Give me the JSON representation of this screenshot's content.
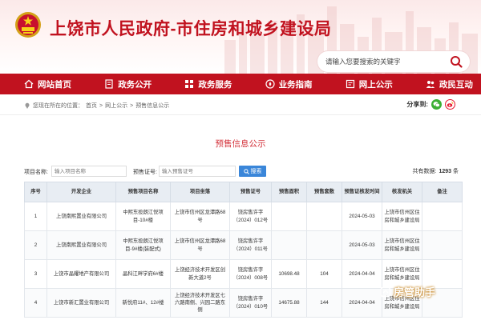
{
  "header": {
    "title": "上饶市人民政府-市住房和城乡建设局",
    "search_placeholder": "请输入您要搜索的关键字"
  },
  "nav": {
    "items": [
      {
        "label": "网站首页",
        "icon": "home-icon"
      },
      {
        "label": "政务公开",
        "icon": "document-icon"
      },
      {
        "label": "政务服务",
        "icon": "grid-icon"
      },
      {
        "label": "业务指南",
        "icon": "guide-icon"
      },
      {
        "label": "网上公示",
        "icon": "notice-icon"
      },
      {
        "label": "政民互动",
        "icon": "people-icon"
      }
    ]
  },
  "breadcrumb": {
    "prefix": "您现在所在的位置：",
    "home": "首页",
    "sep": ">",
    "section": "网上公示",
    "current": "预售信息公示"
  },
  "share": {
    "label": "分享到:"
  },
  "page_title": "预售信息公示",
  "filter": {
    "project_label": "项目名称:",
    "project_placeholder": "输入项目名称",
    "cert_label": "预售证号:",
    "cert_placeholder": "输入预售证号",
    "search_button": "搜索",
    "total_label": "共有数据:",
    "total_count": "1293",
    "total_unit": "条"
  },
  "table": {
    "headers": [
      "序号",
      "开发企业",
      "预售项目名称",
      "项目坐落",
      "预售证号",
      "预售面积",
      "预售套数",
      "预售证核发时间",
      "核发机关",
      "备注"
    ],
    "rows": [
      {
        "no": "1",
        "company": "上饶南熙置业有限公司",
        "project": "中熙东投朗江悦项目-10#楼",
        "location": "上饶市信州区龙潭路68号",
        "cert": "饶房售许字（2024）012号",
        "area": "",
        "units": "",
        "date": "2024-05-03",
        "authority": "上饶市信州区住房和城乡建设局",
        "remark": ""
      },
      {
        "no": "2",
        "company": "上饶南熙置业有限公司",
        "project": "中熙东投朗江悦项目-9#楼(装配式)",
        "location": "上饶市信州区龙潭路68号",
        "cert": "饶房售许字（2024）011号",
        "area": "",
        "units": "",
        "date": "2024-05-03",
        "authority": "上饶市信州区住房和城乡建设局",
        "remark": ""
      },
      {
        "no": "3",
        "company": "上饶市晶耀地产有限公司",
        "project": "晶科江畔学府6#楼",
        "location": "上饶经济技术开发区创新大道2号",
        "cert": "饶房售许字（2024）008号",
        "area": "10698.48",
        "units": "104",
        "date": "2024-04-04",
        "authority": "上饶市信州区住房和城乡建设局",
        "remark": ""
      },
      {
        "no": "4",
        "company": "上饶市新汇置业有限公司",
        "project": "新悦府11#、12#楼",
        "location": "上饶经济技术开发区七六路南侧、兴园二路东侧",
        "cert": "饶房售许字（2024）010号",
        "area": "14675.88",
        "units": "144",
        "date": "2024-04-04",
        "authority": "上饶市信州区住房和城乡建设局",
        "remark": ""
      }
    ]
  },
  "watermark": {
    "text": "房管助手"
  }
}
